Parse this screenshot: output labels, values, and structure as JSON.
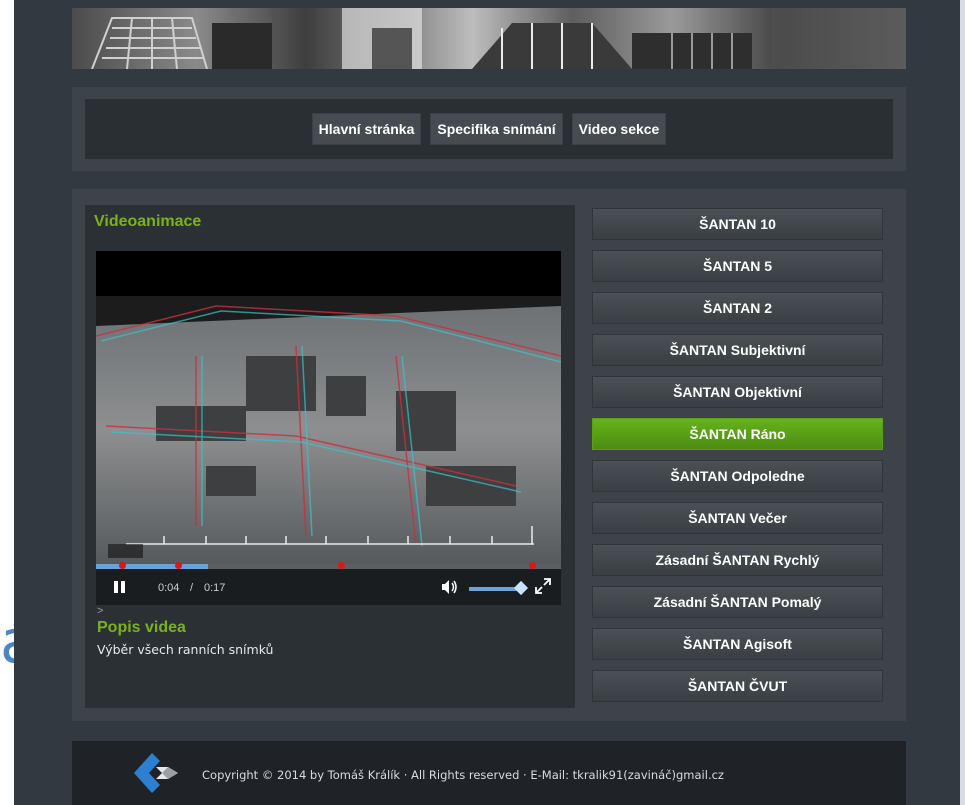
{
  "background": {
    "partial_letter": "á"
  },
  "nav": {
    "items": [
      {
        "label": "Hlavní stránka"
      },
      {
        "label": "Specifika snímání"
      },
      {
        "label": "Video sekce"
      }
    ]
  },
  "main": {
    "section_title": "Videoanimace",
    "video": {
      "current_time": "0:04",
      "separator": "/",
      "duration": "0:17",
      "progress_fraction": 0.24,
      "volume_fraction": 0.9
    },
    "description_marker": ">",
    "description_title": "Popis videa",
    "description_text": "Výběr všech ranních snímků"
  },
  "sidebar": {
    "items": [
      {
        "label": "ŠANTAN 10",
        "active": false
      },
      {
        "label": "ŠANTAN 5",
        "active": false
      },
      {
        "label": "ŠANTAN 2",
        "active": false
      },
      {
        "label": "ŠANTAN Subjektivní",
        "active": false
      },
      {
        "label": "ŠANTAN Objektivní",
        "active": false
      },
      {
        "label": "ŠANTAN Ráno",
        "active": true
      },
      {
        "label": "ŠANTAN Odpoledne",
        "active": false
      },
      {
        "label": "ŠANTAN Večer",
        "active": false
      },
      {
        "label": "Zásadní ŠANTAN Rychlý",
        "active": false
      },
      {
        "label": "Zásadní ŠANTAN Pomalý",
        "active": false
      },
      {
        "label": "ŠANTAN Agisoft",
        "active": false
      },
      {
        "label": "ŠANTAN ČVUT",
        "active": false
      }
    ]
  },
  "footer": {
    "text": "Copyright © 2014 by Tomáš Králík  ·  All Rights reserved  ·  E-Mail: tkralik91(zavináč)gmail.cz"
  },
  "colors": {
    "accent_green": "#7ab317",
    "active_item": "#5aa015",
    "page_bg": "#333940"
  }
}
